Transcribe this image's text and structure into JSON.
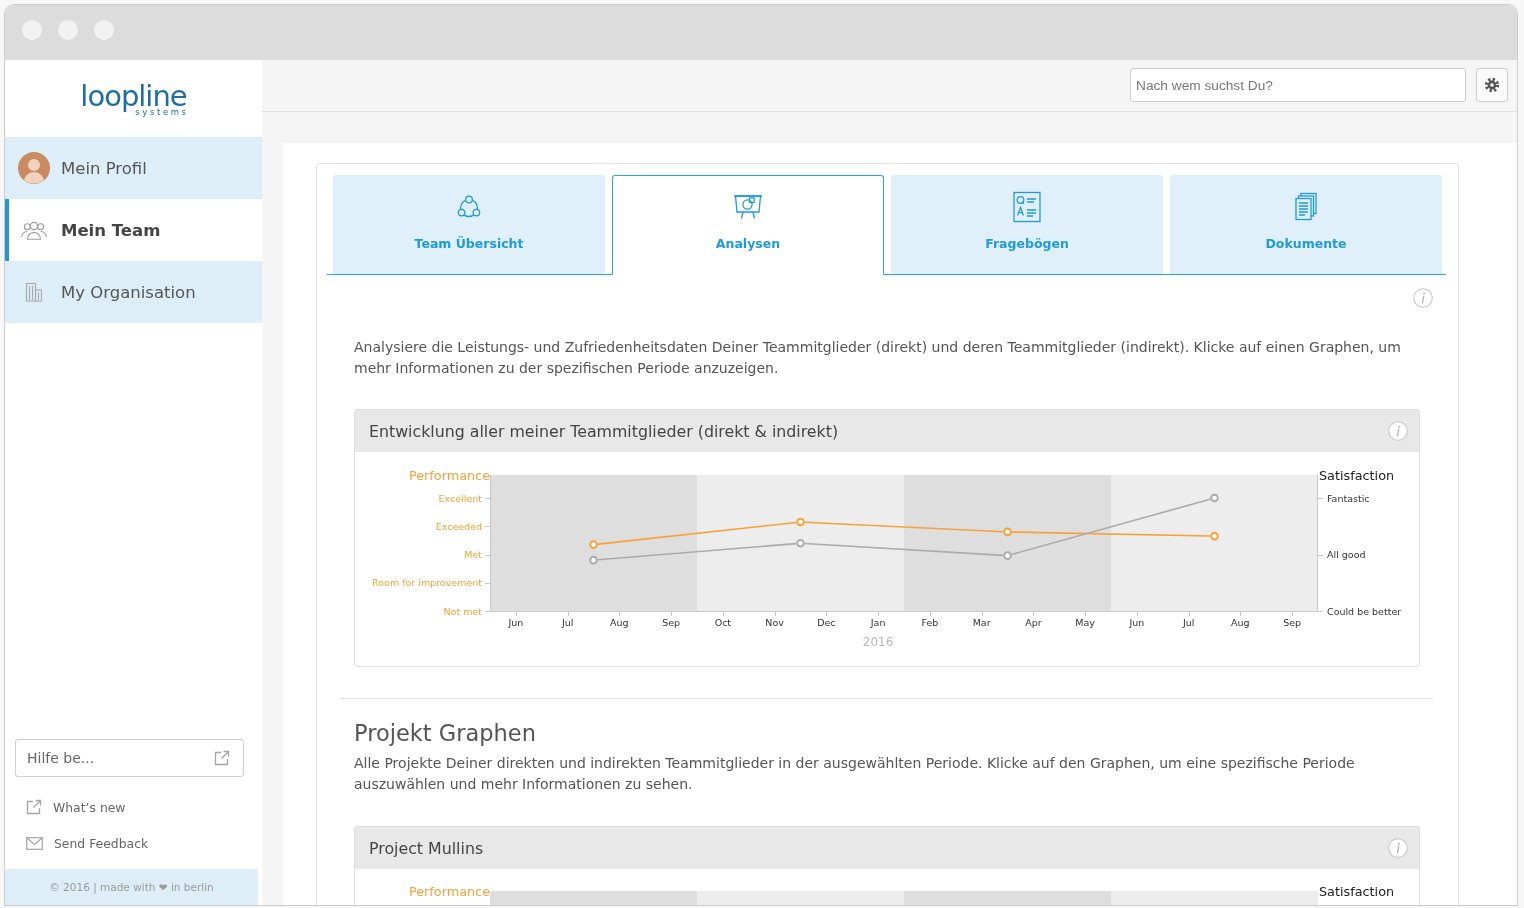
{
  "sidebar": {
    "logo": {
      "wordmark": "loopline",
      "tagline": "systems"
    },
    "nav": [
      {
        "label": "Mein Profil",
        "selected": false
      },
      {
        "label": "Mein Team",
        "selected": true
      },
      {
        "label": "My Organisation",
        "selected": false
      }
    ],
    "help_button": {
      "label": "Hilfe be..."
    },
    "links": [
      {
        "label": "What’s new"
      },
      {
        "label": "Send Feedback"
      }
    ],
    "footer": "© 2016 | made with ❤ in berlin"
  },
  "top_bar": {
    "search": {
      "placeholder": "Nach wem suchst Du?"
    }
  },
  "tabs": [
    {
      "label": "Team Übersicht",
      "selected": false
    },
    {
      "label": "Analysen",
      "selected": true
    },
    {
      "label": "Fragebögen",
      "selected": false
    },
    {
      "label": "Dokumente",
      "selected": false
    }
  ],
  "intro": "Analysiere die Leistungs- und Zufriedenheitsdaten Deiner Teammitglieder (direkt) und deren Teammitglieder (indirekt). Klicke auf einen Graphen, um mehr Informationen zu der spezifischen Periode anzuzeigen.",
  "development_chart": {
    "title": "Entwicklung aller meiner Teammitglieder (direkt & indirekt)",
    "left_axis": {
      "title": "Performance",
      "levels": [
        "Excellent",
        "Exceeded",
        "Met",
        "Room for improvement",
        "Not met"
      ]
    },
    "right_axis": {
      "title": "Satisfaction",
      "levels": [
        "Fantastic",
        "All good",
        "Could be better"
      ]
    },
    "months": [
      "Jun",
      "Jul",
      "Aug",
      "Sep",
      "Oct",
      "Nov",
      "Dec",
      "Jan",
      "Feb",
      "Mar",
      "Apr",
      "May",
      "Jun",
      "Jul",
      "Aug",
      "Sep"
    ],
    "year_label": "2016"
  },
  "projects_section": {
    "heading": "Projekt Graphen",
    "description": "Alle Projekte Deiner direkten und indirekten Teammitglieder in der ausgewählten Periode. Klicke auf den Graphen, um eine spezifische Periode auszuwählen und mehr Informationen zu sehen.",
    "projects": [
      {
        "title": "Project Mullins",
        "left_axis_label": "Performance",
        "right_axis_label": "Satisfaction"
      }
    ]
  }
}
